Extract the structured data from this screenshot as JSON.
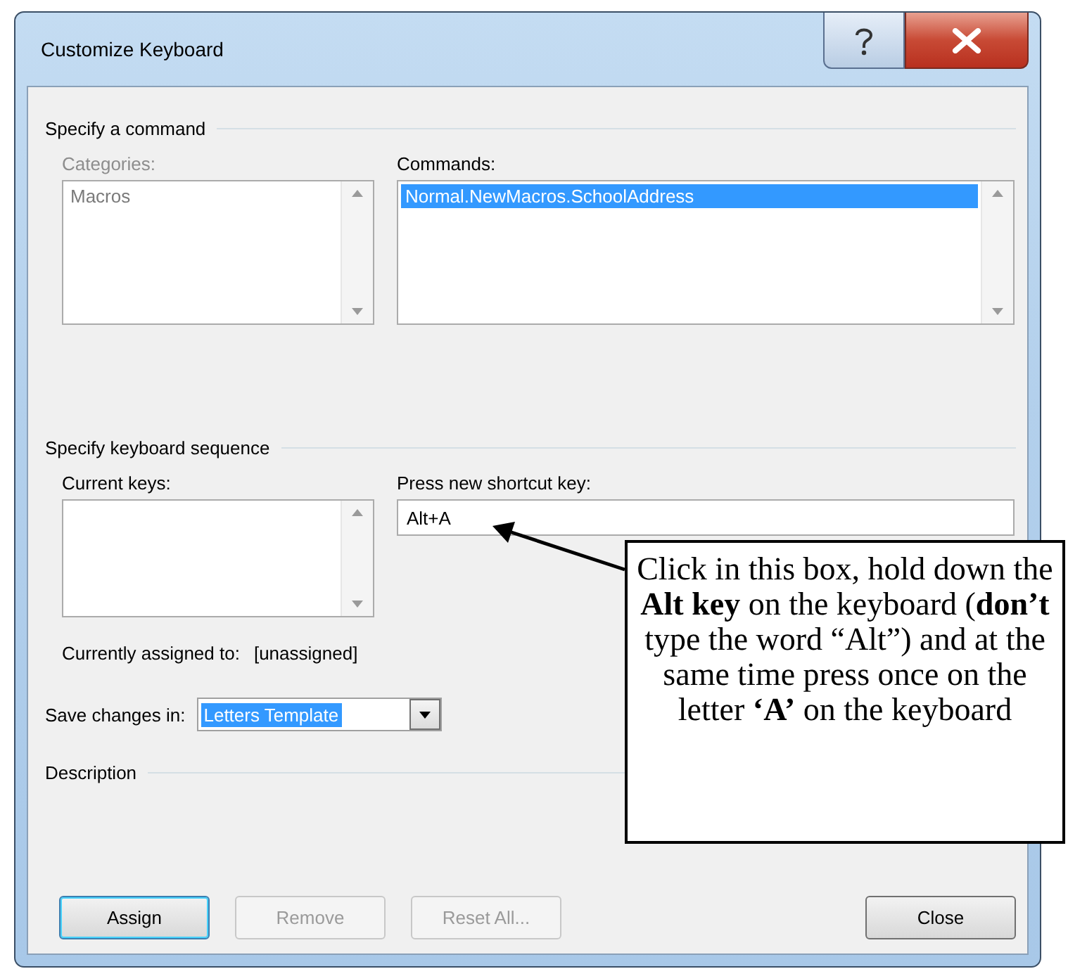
{
  "window": {
    "title": "Customize Keyboard"
  },
  "command_section": {
    "heading": "Specify a command",
    "categories": {
      "label": "Categories:",
      "disabled": true,
      "items": [
        {
          "text": "Macros",
          "selected": false
        }
      ]
    },
    "commands": {
      "label": "Commands:",
      "disabled": false,
      "items": [
        {
          "text": "Normal.NewMacros.SchoolAddress",
          "selected": true
        }
      ]
    }
  },
  "keyboard_section": {
    "heading": "Specify keyboard sequence",
    "current_keys": {
      "label": "Current keys:"
    },
    "new_shortcut": {
      "label": "Press new shortcut key:",
      "value": "Alt+A"
    },
    "assigned_label": "Currently assigned to:",
    "assigned_value": "[unassigned]"
  },
  "save_in": {
    "label": "Save changes in:",
    "value": "Letters Template",
    "selected": true
  },
  "description": {
    "heading": "Description"
  },
  "buttons": [
    {
      "label": "Assign",
      "default": true,
      "disabled": false,
      "kind": "action"
    },
    {
      "label": "Remove",
      "default": false,
      "disabled": true,
      "kind": "action"
    },
    {
      "label": "Reset All...",
      "default": false,
      "disabled": true,
      "kind": "action"
    },
    {
      "label": "Close",
      "default": false,
      "disabled": false,
      "kind": "dismiss"
    }
  ],
  "callout": {
    "text": "Click in this box, hold down the **Alt key** on the keyboard (**don’t** type the word “Alt”) and at the same time press once on the letter **‘A’** on the keyboard"
  }
}
